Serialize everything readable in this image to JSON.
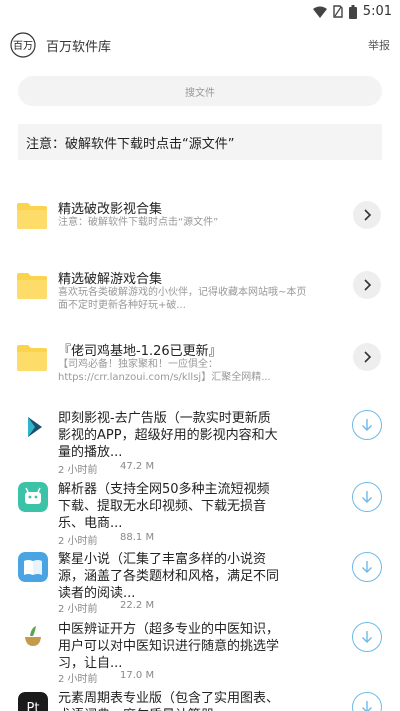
{
  "status_bar": {
    "time": "5:01",
    "icons": [
      "wifi-icon",
      "sim-icon",
      "battery-icon"
    ]
  },
  "header": {
    "title": "百万软件库",
    "report": "举报",
    "logo_text": "百万"
  },
  "search": {
    "placeholder": "搜文件"
  },
  "notice": {
    "text": "注意：破解软件下载时点击“源文件”"
  },
  "folders": [
    {
      "title": "精选破改影视合集",
      "desc": "注意：破解软件下载时点击“源文件”"
    },
    {
      "title": "精选破解游戏合集",
      "desc": "喜欢玩各类破解游戏的小伙伴，记得收藏本网站哦~本页面不定时更新各种好玩+破..."
    },
    {
      "title": "『佬司鸡基地-1.26已更新』",
      "desc": "【司鸡必备！独家聚和！一应俱全：https://crr.lanzoui.com/s/kllsj】汇聚全网精..."
    }
  ],
  "apps": [
    {
      "name": "即刻影视-去广告版（一款实时更新质影视的APP，超级好用的影视内容和大量的播放...",
      "time": "2 小时前",
      "size": "47.2 M",
      "icon": "play-icon"
    },
    {
      "name": "解析器（支持全网50多种主流短视频下载、提取无水印视频、下载无损音乐、电商...",
      "time": "2 小时前",
      "size": "88.1 M",
      "icon": "android-robot-icon"
    },
    {
      "name": "繁星小说（汇集了丰富多样的小说资源，涵盖了各类题材和风格，满足不同读者的阅读...",
      "time": "2 小时前",
      "size": "22.2 M",
      "icon": "book-icon"
    },
    {
      "name": "中医辨证开方（超多专业的中医知识，用户可以对中医知识进行随意的挑选学习，让自...",
      "time": "2 小时前",
      "size": "17.0 M",
      "icon": "herb-bowl-icon"
    },
    {
      "name": "元素周期表专业版（包含了实用图表、术语词典、摩尔质量计算器...",
      "time": "",
      "size": "",
      "icon": "periodic-table-icon"
    }
  ],
  "colors": {
    "folder": "#fcd34d",
    "download_ring": "#6fb9e8",
    "chart_app": "#3cc2a6",
    "book_app": "#4aa3e2"
  }
}
